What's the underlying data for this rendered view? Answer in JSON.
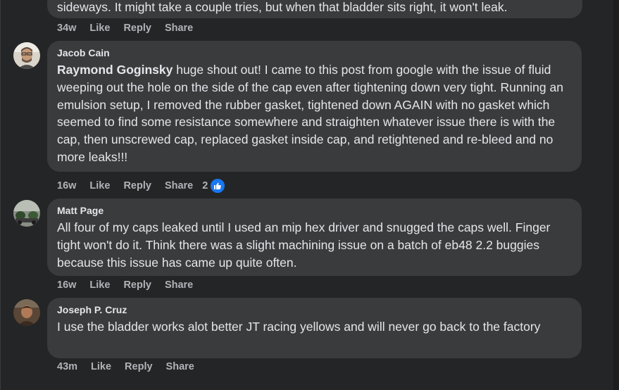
{
  "comments": [
    {
      "text": "sideways. It might take a couple tries, but when that bladder sits right, it won't leak.",
      "actions": {
        "time": "34w",
        "like": "Like",
        "reply": "Reply",
        "share": "Share"
      }
    },
    {
      "author": "Jacob Cain",
      "mention": "Raymond Goginsky",
      "text": " huge shout out! I came to this post from google with the issue of fluid weeping out the hole on the side of the cap even after tightening down very tight. Running an emulsion setup, I removed the rubber gasket, tightened down AGAIN with no gasket which seemed to find some resistance somewhere and straighten whatever issue there is with the cap, then unscrewed cap, replaced gasket inside cap, and retightened and re-bleed and no more leaks!!!",
      "actions": {
        "time": "16w",
        "like": "Like",
        "reply": "Reply",
        "share": "Share"
      },
      "reaction": {
        "count": "2",
        "icon": "thumbs-up-icon",
        "color": "#1877f2"
      }
    },
    {
      "author": "Matt Page",
      "text": "All four of my caps leaked until I used an mip hex driver and snugged the caps well. Finger tight won't do it. Think there was a slight machining issue on a batch of eb48 2.2 buggies because this issue has came up quite often.",
      "actions": {
        "time": "16w",
        "like": "Like",
        "reply": "Reply",
        "share": "Share"
      }
    },
    {
      "author": "Joseph P. Cruz",
      "text": "I use the bladder works alot better JT racing yellows and will never go back to the factory",
      "actions": {
        "time": "43m",
        "like": "Like",
        "reply": "Reply",
        "share": "Share"
      }
    }
  ],
  "colors": {
    "background": "#242526",
    "bubble": "#3a3b3c",
    "text": "#e4e6eb",
    "secondary_text": "#b0b3b8",
    "like_blue": "#1877f2"
  }
}
